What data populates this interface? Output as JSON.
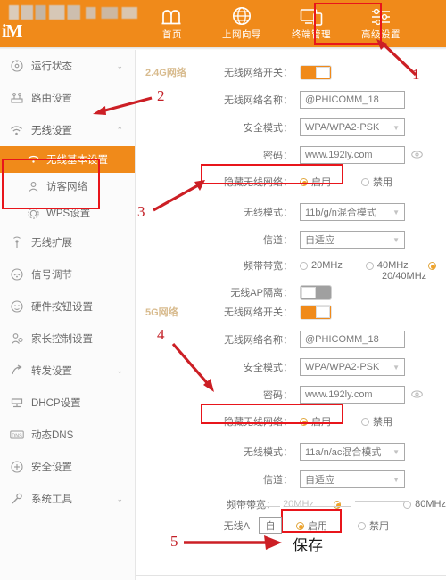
{
  "header": {
    "brand_logo": "iM",
    "nav": [
      {
        "label": "首页",
        "icon": "home-icon"
      },
      {
        "label": "上网向导",
        "icon": "globe-icon"
      },
      {
        "label": "终端管理",
        "icon": "devices-icon"
      },
      {
        "label": "高级设置",
        "icon": "sliders-icon"
      }
    ]
  },
  "sidebar": {
    "items": [
      {
        "label": "运行状态",
        "icon": "status-icon",
        "expandable": true
      },
      {
        "label": "路由设置",
        "icon": "router-icon",
        "expandable": false
      },
      {
        "label": "无线设置",
        "icon": "wifi-icon",
        "expandable": true
      }
    ],
    "sub_items": [
      {
        "label": "无线基本设置",
        "icon": "wifi-small-icon",
        "active": true
      },
      {
        "label": "访客网络",
        "icon": "guest-icon",
        "active": false
      },
      {
        "label": "WPS设置",
        "icon": "wps-icon",
        "active": false
      }
    ],
    "items_after": [
      {
        "label": "无线扩展",
        "icon": "antenna-icon",
        "expandable": false
      },
      {
        "label": "信号调节",
        "icon": "signal-icon",
        "expandable": false
      },
      {
        "label": "硬件按钮设置",
        "icon": "button-icon",
        "expandable": false
      },
      {
        "label": "家长控制设置",
        "icon": "parental-icon",
        "expandable": false
      },
      {
        "label": "转发设置",
        "icon": "forward-icon",
        "expandable": true
      },
      {
        "label": "DHCP设置",
        "icon": "dhcp-icon",
        "expandable": false
      },
      {
        "label": "动态DNS",
        "icon": "dns-icon",
        "expandable": false
      },
      {
        "label": "安全设置",
        "icon": "shield-icon",
        "expandable": false
      },
      {
        "label": "系统工具",
        "icon": "wrench-icon",
        "expandable": true
      }
    ]
  },
  "band_24": {
    "title": "2.4G网络",
    "switch_label": "无线网络开关：",
    "switch_on": true,
    "ssid_label": "无线网络名称：",
    "ssid_value": "@PHICOMM_18",
    "security_label": "安全模式：",
    "security_value": "WPA/WPA2-PSK",
    "password_label": "密码：",
    "password_value": "www.192ly.com",
    "hide_label": "隐藏无线网络：",
    "hide_enable": "启用",
    "hide_disable": "禁用",
    "mode_label": "无线模式：",
    "mode_value": "11b/g/n混合模式",
    "channel_label": "信道：",
    "channel_value": "自适应",
    "bandwidth_label": "频带带宽：",
    "bandwidth_options": [
      "20MHz",
      "40MHz",
      "20/40MHz"
    ],
    "bandwidth_selected": "20/40MHz",
    "ap_isolate_label": "无线AP隔离：",
    "ap_isolate_on": false
  },
  "band_5g": {
    "title": "5G网络",
    "switch_label": "无线网络开关：",
    "switch_on": true,
    "ssid_label": "无线网络名称：",
    "ssid_value": "@PHICOMM_18",
    "security_label": "安全模式：",
    "security_value": "WPA/WPA2-PSK",
    "password_label": "密码：",
    "password_value": "www.192ly.com",
    "hide_label": "隐藏无线网络：",
    "hide_enable": "启用",
    "hide_disable": "禁用",
    "mode_label": "无线模式：",
    "mode_value": "11a/n/ac混合模式",
    "channel_label": "信道：",
    "channel_value": "自适应",
    "bandwidth_label": "频带带宽：",
    "bandwidth_overlap_text": "20MHz",
    "bandwidth_option_80": "80MHz",
    "ap_label_partial": "无线A",
    "small_field_value": "自",
    "hide_enable2": "启用",
    "hide_disable2": "禁用"
  },
  "annotations": {
    "n1": "1",
    "n2": "2",
    "n3": "3",
    "n4": "4",
    "n5": "5",
    "save_text": "保存"
  }
}
